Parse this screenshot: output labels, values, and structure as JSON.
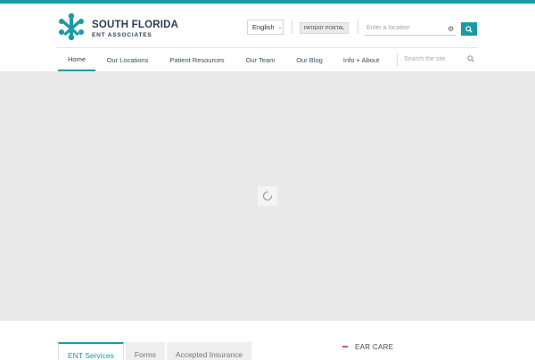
{
  "brand": {
    "name": "SOUTH FLORIDA",
    "subtitle": "ENT ASSOCIATES",
    "accent_color": "#1a9aa6"
  },
  "header": {
    "language": {
      "selected": "English"
    },
    "patient_portal_label": "PATIENT PORTAL",
    "location_search": {
      "placeholder": "Enter a location",
      "icon": "gear-icon",
      "button_icon": "search-icon"
    }
  },
  "nav": {
    "items": [
      {
        "label": "Home",
        "active": true
      },
      {
        "label": "Our Locations",
        "active": false
      },
      {
        "label": "Patient Resources",
        "active": false
      },
      {
        "label": "Our Team",
        "active": false
      },
      {
        "label": "Our Blog",
        "active": false
      },
      {
        "label": "Info + About",
        "active": false
      }
    ],
    "site_search": {
      "placeholder": "Search the site",
      "icon": "search-icon"
    }
  },
  "hero": {
    "state": "loading",
    "icon": "spinner-icon"
  },
  "content": {
    "tabs": [
      {
        "label": "ENT Services",
        "active": true
      },
      {
        "label": "Forms",
        "active": false
      },
      {
        "label": "Accepted Insurance",
        "active": false
      }
    ],
    "side_list": [
      {
        "label": "EAR CARE",
        "marker_color": "#d9534f"
      }
    ]
  }
}
